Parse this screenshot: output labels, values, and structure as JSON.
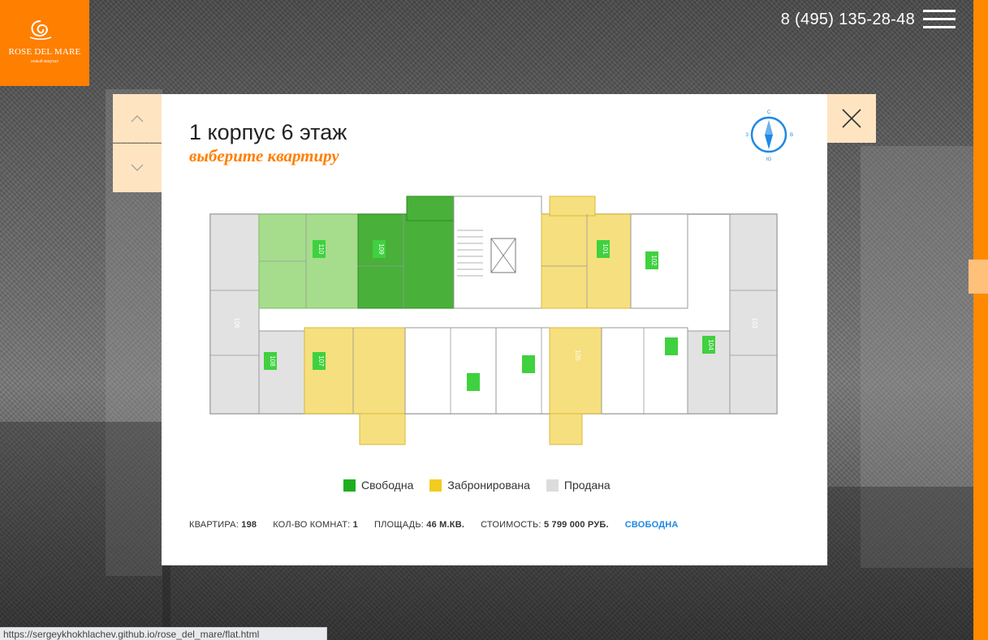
{
  "header": {
    "logo": {
      "title": "ROSE DEL MARE",
      "subtitle": "новый квартал"
    },
    "phone": "8 (495) 135-28-48"
  },
  "icons": {
    "menu": "hamburger-menu-icon",
    "up": "chevron-up-icon",
    "down": "chevron-down-icon",
    "close": "close-icon",
    "compass": "compass-icon",
    "logo": "rose-logo-icon"
  },
  "modal": {
    "title": "1 корпус 6 этаж",
    "subtitle": "выберите квартиру"
  },
  "plan": {
    "apartments": [
      {
        "number": "101",
        "status": "reserved"
      },
      {
        "number": "102",
        "status": "free"
      },
      {
        "number": "103",
        "status": "sold"
      },
      {
        "number": "104",
        "status": "sold"
      },
      {
        "number": "105",
        "status": "reserved"
      },
      {
        "number": "106",
        "status": "sold"
      },
      {
        "number": "107",
        "status": "reserved"
      },
      {
        "number": "108",
        "status": "sold"
      },
      {
        "number": "109",
        "status": "free"
      },
      {
        "number": "110",
        "status": "free"
      }
    ]
  },
  "legend": [
    {
      "label": "Свободна",
      "color": "#1fae1f"
    },
    {
      "label": "Забронирована",
      "color": "#f2cc1f"
    },
    {
      "label": "Продана",
      "color": "#dcdcdc"
    }
  ],
  "info": {
    "apartment_label": "КВАРТИРА:",
    "apartment_value": "198",
    "rooms_label": "КОЛ-ВО КОМНАТ:",
    "rooms_value": "1",
    "area_label": "ПЛОЩАДЬ:",
    "area_value": "46 М.КВ.",
    "price_label": "СТОИМОСТЬ:",
    "price_value": "5 799 000 РУБ.",
    "status": "СВОБОДНА"
  },
  "browser": {
    "status_url": "https://sergeykhokhlachev.github.io/rose_del_mare/flat.html"
  }
}
